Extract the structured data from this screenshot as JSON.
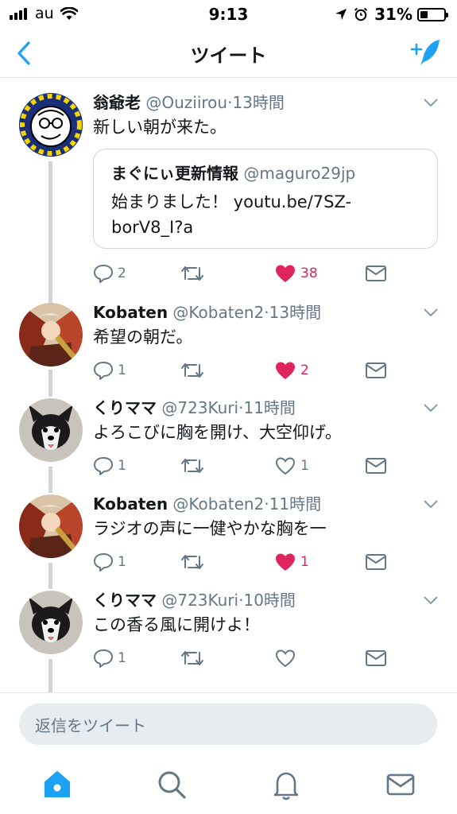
{
  "status_bar": {
    "carrier": "au",
    "time": "9:13",
    "battery": "31%"
  },
  "nav": {
    "title": "ツイート"
  },
  "colors": {
    "accent": "#1da1f2",
    "like": "#e0245e",
    "muted": "#657786",
    "connector": "#ccd6dd"
  },
  "tweets": [
    {
      "name": "翁爺老",
      "handle": "@Ouziirou",
      "time": "13時間",
      "text": "新しい朝が来た。",
      "quote": {
        "name": "まぐにぃ更新情報",
        "handle": "@maguro29jp",
        "line1": "始まりました！ youtu.be/7SZ-",
        "line2": "borV8_I?a"
      },
      "replies": "2",
      "retweets": "",
      "likes": "38",
      "liked": true
    },
    {
      "name": "Kobaten",
      "handle": "@Kobaten2",
      "time": "13時間",
      "text": "希望の朝だ。",
      "replies": "1",
      "retweets": "",
      "likes": "2",
      "liked": true
    },
    {
      "name": "くりママ",
      "handle": "@723Kuri",
      "time": "11時間",
      "text": "よろこびに胸を開け、大空仰げ。",
      "replies": "1",
      "retweets": "",
      "likes": "1",
      "liked": false
    },
    {
      "name": "Kobaten",
      "handle": "@Kobaten2",
      "time": "11時間",
      "text": "ラジオの声に一健やかな胸を一",
      "replies": "1",
      "retweets": "",
      "likes": "1",
      "liked": true
    },
    {
      "name": "くりママ",
      "handle": "@723Kuri",
      "time": "10時間",
      "text": "この香る風に開けよ！",
      "replies": "1",
      "retweets": "",
      "likes": "",
      "liked": false
    }
  ],
  "reply_bar": {
    "placeholder": "返信をツイート"
  },
  "tabbar": {
    "icons": [
      "home-icon",
      "search-icon",
      "notifications-icon",
      "messages-icon"
    ]
  }
}
